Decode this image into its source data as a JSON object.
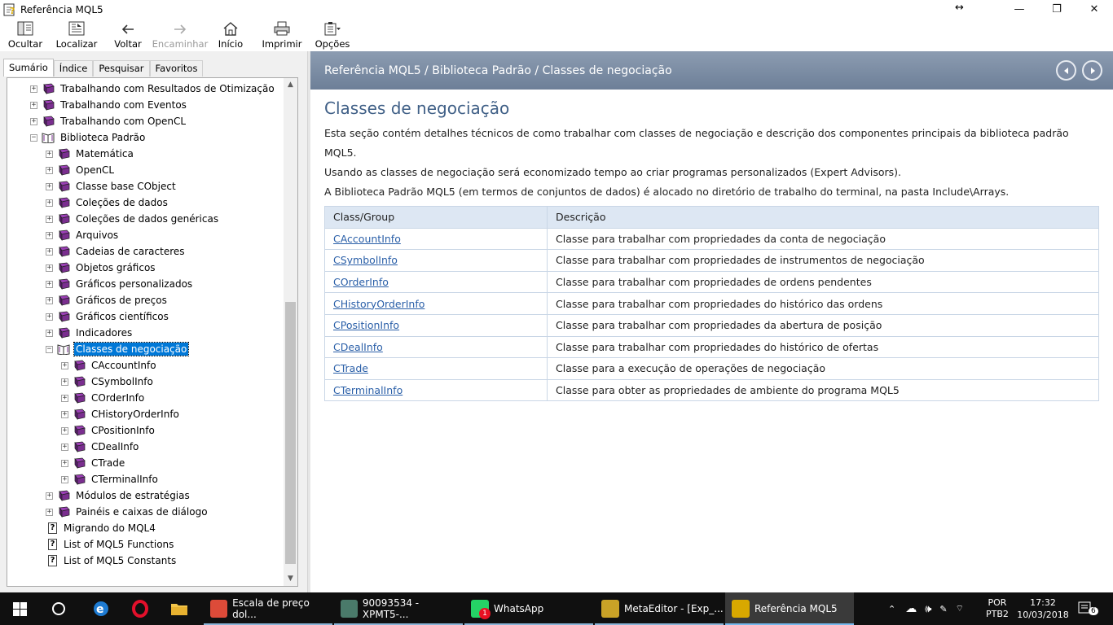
{
  "window": {
    "title": "Referência MQL5",
    "resize_glyph": "↔",
    "minimize": "—",
    "maximize": "❐",
    "close": "✕"
  },
  "toolbar": {
    "items": [
      {
        "label": "Ocultar",
        "icon": "hide-pane-icon",
        "enabled": true
      },
      {
        "label": "Localizar",
        "icon": "locate-icon",
        "enabled": true
      },
      {
        "label": "Voltar",
        "icon": "back-arrow-icon",
        "enabled": true
      },
      {
        "label": "Encaminhar",
        "icon": "forward-arrow-icon",
        "enabled": false
      },
      {
        "label": "Início",
        "icon": "home-icon",
        "enabled": true
      },
      {
        "label": "Imprimir",
        "icon": "printer-icon",
        "enabled": true
      },
      {
        "label": "Opções",
        "icon": "options-icon",
        "enabled": true
      }
    ]
  },
  "tabs": [
    "Sumário",
    "Índice",
    "Pesquisar",
    "Favoritos"
  ],
  "tree": [
    {
      "label": "Trabalhando com Resultados de Otimização",
      "level": 1,
      "pm": "+",
      "icon": "book"
    },
    {
      "label": "Trabalhando com Eventos",
      "level": 1,
      "pm": "+",
      "icon": "book"
    },
    {
      "label": "Trabalhando com OpenCL",
      "level": 1,
      "pm": "+",
      "icon": "book"
    },
    {
      "label": "Biblioteca Padrão",
      "level": 1,
      "pm": "−",
      "icon": "open-book"
    },
    {
      "label": "Matemática",
      "level": 2,
      "pm": "+",
      "icon": "book"
    },
    {
      "label": "OpenCL",
      "level": 2,
      "pm": "+",
      "icon": "book"
    },
    {
      "label": "Classe base CObject",
      "level": 2,
      "pm": "+",
      "icon": "book"
    },
    {
      "label": "Coleções de dados",
      "level": 2,
      "pm": "+",
      "icon": "book"
    },
    {
      "label": "Coleções de dados genéricas",
      "level": 2,
      "pm": "+",
      "icon": "book"
    },
    {
      "label": "Arquivos",
      "level": 2,
      "pm": "+",
      "icon": "book"
    },
    {
      "label": "Cadeias de caracteres",
      "level": 2,
      "pm": "+",
      "icon": "book"
    },
    {
      "label": "Objetos gráficos",
      "level": 2,
      "pm": "+",
      "icon": "book"
    },
    {
      "label": "Gráficos personalizados",
      "level": 2,
      "pm": "+",
      "icon": "book"
    },
    {
      "label": "Gráficos de preços",
      "level": 2,
      "pm": "+",
      "icon": "book"
    },
    {
      "label": "Gráficos científicos",
      "level": 2,
      "pm": "+",
      "icon": "book"
    },
    {
      "label": "Indicadores",
      "level": 2,
      "pm": "+",
      "icon": "book"
    },
    {
      "label": "Classes de negociação",
      "level": 2,
      "pm": "−",
      "icon": "open-book",
      "selected": true
    },
    {
      "label": "CAccountInfo",
      "level": 3,
      "pm": "+",
      "icon": "book"
    },
    {
      "label": "CSymbolInfo",
      "level": 3,
      "pm": "+",
      "icon": "book"
    },
    {
      "label": "COrderInfo",
      "level": 3,
      "pm": "+",
      "icon": "book"
    },
    {
      "label": "CHistoryOrderInfo",
      "level": 3,
      "pm": "+",
      "icon": "book"
    },
    {
      "label": "CPositionInfo",
      "level": 3,
      "pm": "+",
      "icon": "book"
    },
    {
      "label": "CDealInfo",
      "level": 3,
      "pm": "+",
      "icon": "book"
    },
    {
      "label": "CTrade",
      "level": 3,
      "pm": "+",
      "icon": "book"
    },
    {
      "label": "CTerminalInfo",
      "level": 3,
      "pm": "+",
      "icon": "book"
    },
    {
      "label": "Módulos de estratégias",
      "level": 2,
      "pm": "+",
      "icon": "book"
    },
    {
      "label": "Painéis e caixas de diálogo",
      "level": 2,
      "pm": "+",
      "icon": "book"
    },
    {
      "label": "Migrando do MQL4",
      "level": 1,
      "pm": "",
      "icon": "help-page"
    },
    {
      "label": "List of MQL5 Functions",
      "level": 1,
      "pm": "",
      "icon": "help-page"
    },
    {
      "label": "List of MQL5 Constants",
      "level": 1,
      "pm": "",
      "icon": "help-page"
    }
  ],
  "header": {
    "breadcrumb": "Referência MQL5 / Biblioteca Padrão / Classes de negociação"
  },
  "content": {
    "title": "Classes de negociação",
    "paragraphs": [
      "Esta seção contém detalhes técnicos de como trabalhar com classes de negociação e descrição dos componentes principais da biblioteca padrão MQL5.",
      "Usando as classes de negociação será economizado tempo ao criar programas personalizados (Expert Advisors).",
      "A Biblioteca Padrão MQL5 (em termos de conjuntos de dados) é alocado no diretório de trabalho do terminal, na pasta Include\\Arrays."
    ],
    "table": {
      "headers": [
        "Class/Group",
        "Descrição"
      ],
      "rows": [
        [
          "CAccountInfo",
          "Classe para trabalhar com propriedades da conta de negociação"
        ],
        [
          "CSymbolInfo",
          "Classe para trabalhar com propriedades de instrumentos de negociação"
        ],
        [
          "COrderInfo",
          "Classe para trabalhar com propriedades de ordens pendentes"
        ],
        [
          "CHistoryOrderInfo",
          "Classe para trabalhar com propriedades do histórico das ordens"
        ],
        [
          "CPositionInfo",
          "Classe para trabalhar com propriedades da abertura de posição"
        ],
        [
          "CDealInfo",
          "Classe para trabalhar com propriedades do histórico de ofertas"
        ],
        [
          "CTrade",
          "Classe para a execução de operações de negociação"
        ],
        [
          "CTerminalInfo",
          "Classe para obter as propriedades de ambiente do programa MQL5"
        ]
      ]
    }
  },
  "taskbar": {
    "apps": [
      {
        "label": "Escala de preço dol...",
        "icon": "chrome-icon"
      },
      {
        "label": "90093534 - XPMT5-...",
        "icon": "metatrader-icon"
      },
      {
        "label": "WhatsApp",
        "icon": "whatsapp-icon",
        "badge": "1"
      },
      {
        "label": "MetaEditor - [Exp_...",
        "icon": "metaeditor-icon"
      },
      {
        "label": "Referência MQL5",
        "icon": "help-icon",
        "active": true
      }
    ],
    "lang": "POR",
    "layout": "PTB2",
    "time": "17:32",
    "date": "10/03/2018",
    "notifications": "6"
  }
}
